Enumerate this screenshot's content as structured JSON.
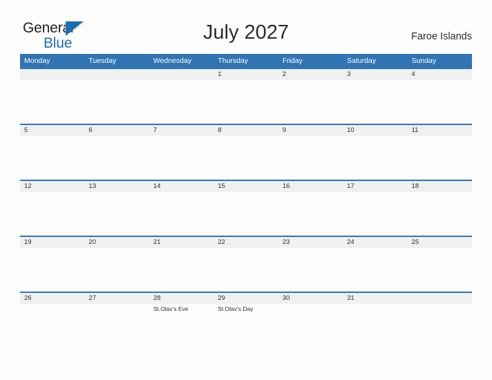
{
  "logo": {
    "text_primary": "General",
    "text_secondary": "Blue",
    "mark": "triangle-flag-icon",
    "color_primary": "#231f20",
    "color_secondary": "#1c6fb5"
  },
  "header": {
    "title": "July 2027",
    "region": "Faroe Islands"
  },
  "theme": {
    "header_blue": "#3174b4",
    "band_gray": "#f0f0f0",
    "page_background": "#fdfdfe",
    "text": "#2b2b2b"
  },
  "weekdays": [
    "Monday",
    "Tuesday",
    "Wednesday",
    "Thursday",
    "Friday",
    "Saturday",
    "Sunday"
  ],
  "weeks": [
    [
      {
        "day": ""
      },
      {
        "day": ""
      },
      {
        "day": ""
      },
      {
        "day": "1"
      },
      {
        "day": "2"
      },
      {
        "day": "3"
      },
      {
        "day": "4"
      }
    ],
    [
      {
        "day": "5"
      },
      {
        "day": "6"
      },
      {
        "day": "7"
      },
      {
        "day": "8"
      },
      {
        "day": "9"
      },
      {
        "day": "10"
      },
      {
        "day": "11"
      }
    ],
    [
      {
        "day": "12"
      },
      {
        "day": "13"
      },
      {
        "day": "14"
      },
      {
        "day": "15"
      },
      {
        "day": "16"
      },
      {
        "day": "17"
      },
      {
        "day": "18"
      }
    ],
    [
      {
        "day": "19"
      },
      {
        "day": "20"
      },
      {
        "day": "21"
      },
      {
        "day": "22"
      },
      {
        "day": "23"
      },
      {
        "day": "24"
      },
      {
        "day": "25"
      }
    ],
    [
      {
        "day": "26"
      },
      {
        "day": "27"
      },
      {
        "day": "28",
        "event": "St.Olav's Eve"
      },
      {
        "day": "29",
        "event": "St.Olav's Day"
      },
      {
        "day": "30"
      },
      {
        "day": "31"
      },
      {
        "day": ""
      }
    ]
  ]
}
